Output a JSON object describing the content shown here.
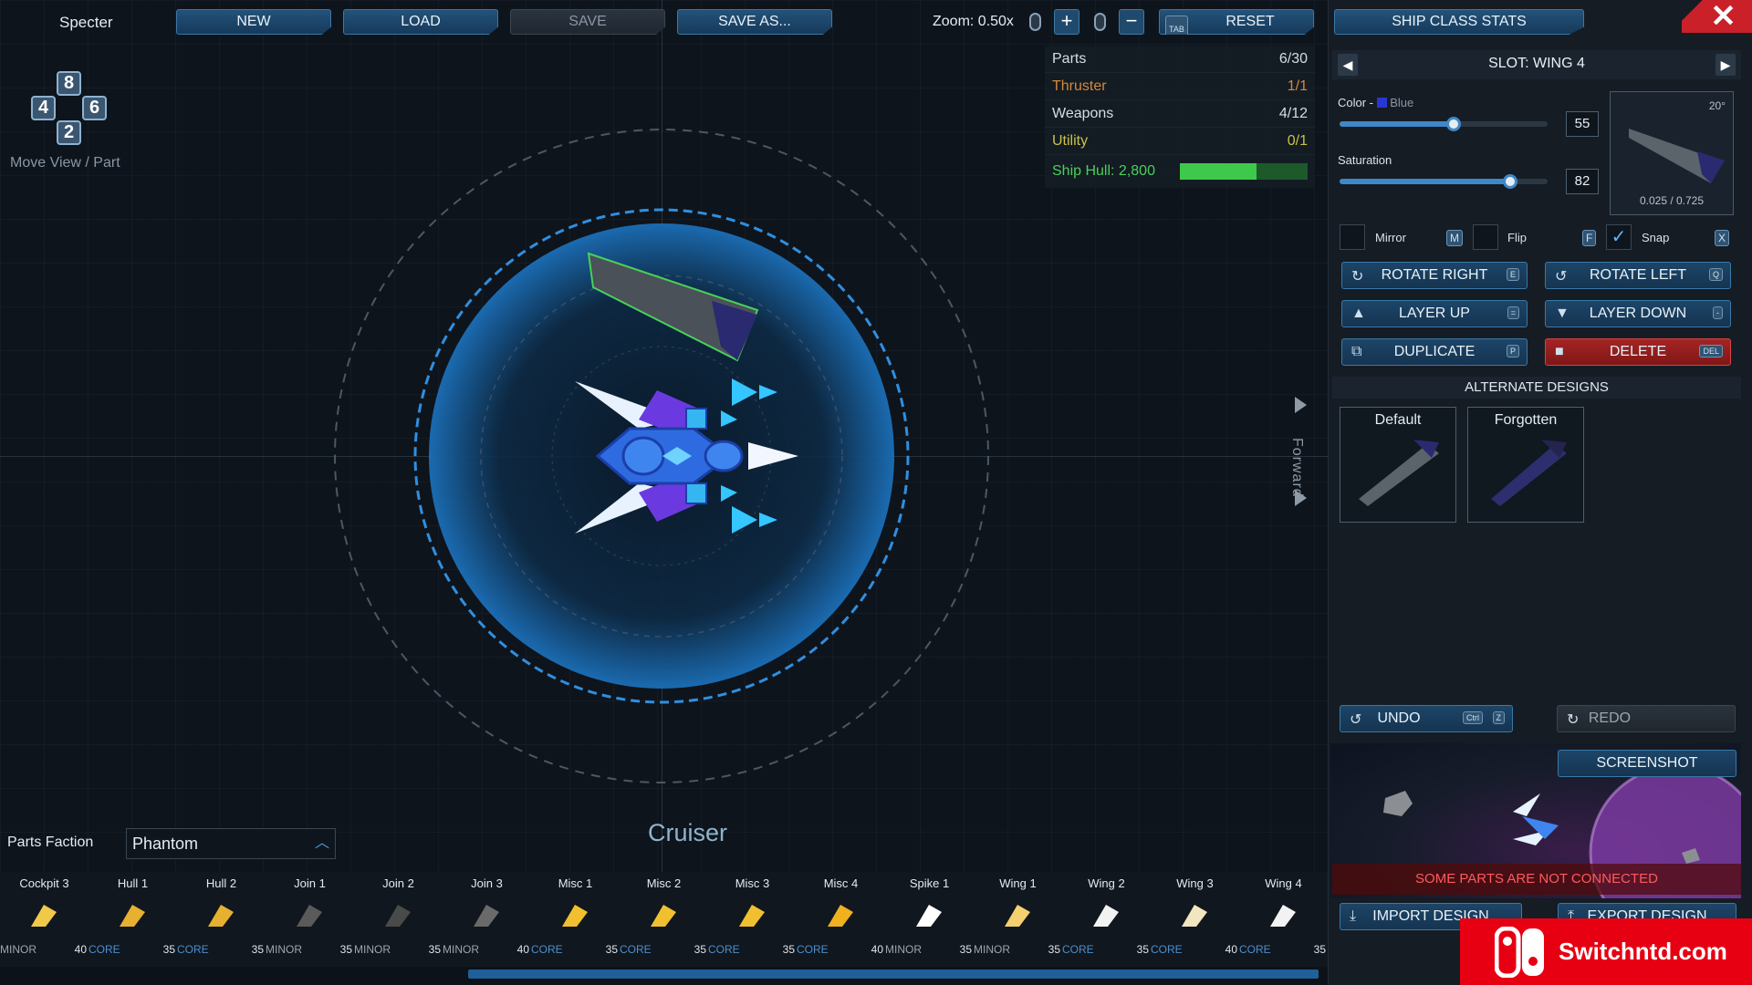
{
  "top": {
    "ship_name": "Specter",
    "buttons": {
      "new": "NEW",
      "load": "LOAD",
      "save": "SAVE",
      "save_as": "SAVE AS...",
      "reset": "RESET"
    },
    "zoom_label": "Zoom: 0.50x",
    "zoom_in": "+",
    "zoom_out": "−",
    "tab_key": "TAB"
  },
  "keypad": {
    "up": "8",
    "left": "4",
    "right": "6",
    "down": "2",
    "label": "Move View / Part"
  },
  "stats": {
    "rows": [
      {
        "label": "Parts",
        "value": "6/30",
        "color": "#d6dde6"
      },
      {
        "label": "Thruster",
        "value": "1/1",
        "color": "#d28a3a"
      },
      {
        "label": "Weapons",
        "value": "4/12",
        "color": "#d6dde6"
      },
      {
        "label": "Utility",
        "value": "0/1",
        "color": "#c9c249"
      }
    ],
    "hull_label": "Ship Hull: 2,800",
    "hull_fraction": 0.6
  },
  "forward_label": "Forward",
  "class_name": "Cruiser",
  "panel": {
    "ship_class_stats": "SHIP CLASS STATS",
    "slot_title": "SLOT: WING 4",
    "color_label": "Color - ",
    "color_name": "Blue",
    "color_swatch": "#2a35d6",
    "color_value": "55",
    "color_fraction": 0.55,
    "saturation_label": "Saturation",
    "saturation_value": "82",
    "saturation_fraction": 0.82,
    "preview_angle": "20°",
    "preview_coords": "0.025 / 0.725",
    "mirror": {
      "label": "Mirror",
      "key": "M"
    },
    "flip": {
      "label": "Flip",
      "key": "F"
    },
    "snap": {
      "label": "Snap",
      "key": "X",
      "checked": true
    },
    "rotate_right": {
      "label": "ROTATE RIGHT",
      "key": "E"
    },
    "rotate_left": {
      "label": "ROTATE LEFT",
      "key": "Q"
    },
    "layer_up": {
      "label": "LAYER UP",
      "key": "="
    },
    "layer_down": {
      "label": "LAYER DOWN",
      "key": "-"
    },
    "duplicate": {
      "label": "DUPLICATE",
      "key": "P"
    },
    "delete": {
      "label": "DELETE",
      "key": "DEL"
    },
    "alt_header": "ALTERNATE DESIGNS",
    "alt_designs": [
      "Default",
      "Forgotten"
    ],
    "undo": {
      "label": "UNDO",
      "key1": "Ctrl",
      "key2": "Z"
    },
    "redo": {
      "label": "REDO"
    },
    "screenshot": "SCREENSHOT",
    "warning": "SOME PARTS ARE NOT CONNECTED",
    "import": "IMPORT DESIGN",
    "export": "EXPORT DESIGN"
  },
  "faction": {
    "label": "Parts Faction",
    "value": "Phantom"
  },
  "parts": [
    {
      "name": "Cockpit 3",
      "tier": "MINOR",
      "cost": "40"
    },
    {
      "name": "Hull 1",
      "tier": "CORE",
      "cost": "35"
    },
    {
      "name": "Hull 2",
      "tier": "CORE",
      "cost": "35"
    },
    {
      "name": "Join 1",
      "tier": "MINOR",
      "cost": "35"
    },
    {
      "name": "Join 2",
      "tier": "MINOR",
      "cost": "35"
    },
    {
      "name": "Join 3",
      "tier": "MINOR",
      "cost": "40"
    },
    {
      "name": "Misc 1",
      "tier": "CORE",
      "cost": "35"
    },
    {
      "name": "Misc 2",
      "tier": "CORE",
      "cost": "35"
    },
    {
      "name": "Misc 3",
      "tier": "CORE",
      "cost": "35"
    },
    {
      "name": "Misc 4",
      "tier": "CORE",
      "cost": "40"
    },
    {
      "name": "Spike 1",
      "tier": "MINOR",
      "cost": "35"
    },
    {
      "name": "Wing 1",
      "tier": "MINOR",
      "cost": "35"
    },
    {
      "name": "Wing 2",
      "tier": "CORE",
      "cost": "35"
    },
    {
      "name": "Wing 3",
      "tier": "CORE",
      "cost": "40"
    },
    {
      "name": "Wing 4",
      "tier": "CORE",
      "cost": "35"
    }
  ],
  "watermark": "Switchntd.com"
}
